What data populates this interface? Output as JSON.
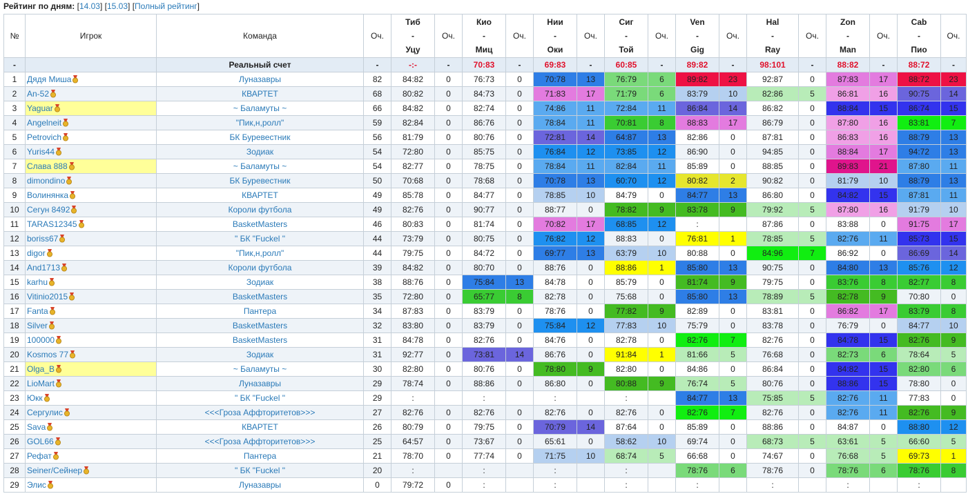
{
  "header": {
    "label": "Рейтинг по дням:",
    "links": [
      {
        "open": "[",
        "text": "14.03",
        "close": "]"
      },
      {
        "open": " [",
        "text": "15.03",
        "close": "]"
      },
      {
        "open": " [",
        "text": "Полный рейтинг",
        "close": "]"
      }
    ]
  },
  "columns": {
    "num": "№",
    "player": "Игрок",
    "team": "Команда",
    "points": "Оч.",
    "matches": [
      {
        "home": "Тиб",
        "sep": "-",
        "away": "Уцу"
      },
      {
        "home": "Кио",
        "sep": "-",
        "away": "Миц"
      },
      {
        "home": "Нии",
        "sep": "-",
        "away": "Оки"
      },
      {
        "home": "Сиг",
        "sep": "-",
        "away": "Той"
      },
      {
        "home": "Ven",
        "sep": "-",
        "away": "Gig"
      },
      {
        "home": "Hal",
        "sep": "-",
        "away": "Ray"
      },
      {
        "home": "Zon",
        "sep": "-",
        "away": "Man"
      },
      {
        "home": "Cab",
        "sep": "-",
        "away": "Пио"
      }
    ],
    "match_points": "Оч."
  },
  "real": {
    "num": "-",
    "label": "Реальный счет",
    "points": "-",
    "matches": [
      {
        "s": "-:-",
        "p": "-"
      },
      {
        "s": "70:83",
        "p": "-"
      },
      {
        "s": "69:83",
        "p": "-"
      },
      {
        "s": "60:85",
        "p": "-"
      },
      {
        "s": "89:82",
        "p": "-"
      },
      {
        "s": "98:101",
        "p": "-"
      },
      {
        "s": "88:82",
        "p": "-"
      },
      {
        "s": "88:72",
        "p": "-"
      }
    ]
  },
  "colors": {
    "23": "#ee1144",
    "21": "#e0148c",
    "17": "#e37bdf",
    "16": "#f0a0e6",
    "15": "#3333ee",
    "14": "#6b65dd",
    "13": "#2e7ee6",
    "12": "#1e90f0",
    "11": "#5aaaf0",
    "10": "#b5d0f0",
    "9": "#44bb22",
    "8": "#3acc33",
    "7": "#11ee11",
    "6": "#7ada7a",
    "5": "#b8ecb8",
    "2": "#e6e62e",
    "1": "#ffff00",
    "0": "none",
    "link": "#2a7ab8",
    "highlight": "#ffff99",
    "real_score": "#e0112b",
    "medal_gold": "#e8b42a",
    "medal_ribbon": "#d9442a"
  },
  "rows": [
    {
      "num": "1",
      "player": "Дядя Миша",
      "team": "Луназавры",
      "points": "82",
      "hl": false,
      "m": [
        [
          "84:82",
          "0"
        ],
        [
          "76:73",
          "0"
        ],
        [
          "70:78",
          "13"
        ],
        [
          "76:79",
          "6"
        ],
        [
          "89:82",
          "23"
        ],
        [
          "92:87",
          "0"
        ],
        [
          "87:83",
          "17"
        ],
        [
          "88:72",
          "23"
        ]
      ]
    },
    {
      "num": "2",
      "player": "An-52",
      "team": "КВАРТЕТ",
      "points": "68",
      "hl": false,
      "m": [
        [
          "80:82",
          "0"
        ],
        [
          "84:73",
          "0"
        ],
        [
          "71:83",
          "17"
        ],
        [
          "71:79",
          "6"
        ],
        [
          "83:79",
          "10"
        ],
        [
          "82:86",
          "5"
        ],
        [
          "86:81",
          "16"
        ],
        [
          "90:75",
          "14"
        ]
      ]
    },
    {
      "num": "3",
      "player": "Yaguar",
      "team": "~ Баламуты ~",
      "points": "66",
      "hl": true,
      "m": [
        [
          "84:82",
          "0"
        ],
        [
          "82:74",
          "0"
        ],
        [
          "74:86",
          "11"
        ],
        [
          "72:84",
          "11"
        ],
        [
          "86:84",
          "14"
        ],
        [
          "86:82",
          "0"
        ],
        [
          "88:84",
          "15"
        ],
        [
          "86:74",
          "15"
        ]
      ]
    },
    {
      "num": "4",
      "player": "Angelneit",
      "team": "\"Пик,н,ролл\"",
      "points": "59",
      "hl": false,
      "m": [
        [
          "82:84",
          "0"
        ],
        [
          "86:76",
          "0"
        ],
        [
          "78:84",
          "11"
        ],
        [
          "70:81",
          "8"
        ],
        [
          "88:83",
          "17"
        ],
        [
          "86:79",
          "0"
        ],
        [
          "87:80",
          "16"
        ],
        [
          "83:81",
          "7"
        ]
      ]
    },
    {
      "num": "5",
      "player": "Petrovich",
      "team": "БК Буревестник",
      "points": "56",
      "hl": false,
      "m": [
        [
          "81:79",
          "0"
        ],
        [
          "80:76",
          "0"
        ],
        [
          "72:81",
          "14"
        ],
        [
          "64:87",
          "13"
        ],
        [
          "82:86",
          "0"
        ],
        [
          "87:81",
          "0"
        ],
        [
          "86:83",
          "16"
        ],
        [
          "88:79",
          "13"
        ]
      ]
    },
    {
      "num": "6",
      "player": "Yuris44",
      "team": "Зодиак",
      "points": "54",
      "hl": false,
      "m": [
        [
          "72:80",
          "0"
        ],
        [
          "85:75",
          "0"
        ],
        [
          "76:84",
          "12"
        ],
        [
          "73:85",
          "12"
        ],
        [
          "86:90",
          "0"
        ],
        [
          "94:85",
          "0"
        ],
        [
          "88:84",
          "17"
        ],
        [
          "94:72",
          "13"
        ]
      ]
    },
    {
      "num": "7",
      "player": "Слава 888",
      "team": "~ Баламуты ~",
      "points": "54",
      "hl": true,
      "m": [
        [
          "82:77",
          "0"
        ],
        [
          "78:75",
          "0"
        ],
        [
          "78:84",
          "11"
        ],
        [
          "82:84",
          "11"
        ],
        [
          "85:89",
          "0"
        ],
        [
          "88:85",
          "0"
        ],
        [
          "89:83",
          "21"
        ],
        [
          "87:80",
          "11"
        ]
      ]
    },
    {
      "num": "8",
      "player": "dimondino",
      "team": "БК Буревестник",
      "points": "50",
      "hl": false,
      "m": [
        [
          "70:68",
          "0"
        ],
        [
          "78:68",
          "0"
        ],
        [
          "70:78",
          "13"
        ],
        [
          "60:70",
          "12"
        ],
        [
          "80:82",
          "2"
        ],
        [
          "90:82",
          "0"
        ],
        [
          "81:79",
          "10"
        ],
        [
          "88:79",
          "13"
        ]
      ]
    },
    {
      "num": "9",
      "player": "Волинянка",
      "team": "КВАРТЕТ",
      "points": "49",
      "hl": false,
      "m": [
        [
          "85:78",
          "0"
        ],
        [
          "84:77",
          "0"
        ],
        [
          "78:85",
          "10"
        ],
        [
          "84:79",
          "0"
        ],
        [
          "84:77",
          "13"
        ],
        [
          "86:80",
          "0"
        ],
        [
          "84:82",
          "15"
        ],
        [
          "87:81",
          "11"
        ]
      ]
    },
    {
      "num": "10",
      "player": "Сегун 8492",
      "team": "Короли футбола",
      "points": "49",
      "hl": false,
      "m": [
        [
          "82:76",
          "0"
        ],
        [
          "90:77",
          "0"
        ],
        [
          "88:77",
          "0"
        ],
        [
          "78:82",
          "9"
        ],
        [
          "83:78",
          "9"
        ],
        [
          "79:92",
          "5"
        ],
        [
          "87:80",
          "16"
        ],
        [
          "91:79",
          "10"
        ]
      ]
    },
    {
      "num": "11",
      "player": "TARAS12345",
      "team": "BasketMasters",
      "points": "46",
      "hl": false,
      "m": [
        [
          "80:83",
          "0"
        ],
        [
          "81:74",
          "0"
        ],
        [
          "70:82",
          "17"
        ],
        [
          "68:85",
          "12"
        ],
        [
          ":",
          ""
        ],
        [
          "87:86",
          "0"
        ],
        [
          "83:88",
          "0"
        ],
        [
          "91:75",
          "17"
        ]
      ]
    },
    {
      "num": "12",
      "player": "boriss67",
      "team": "\" БК \"Fuckel \"",
      "points": "44",
      "hl": false,
      "m": [
        [
          "73:79",
          "0"
        ],
        [
          "80:75",
          "0"
        ],
        [
          "76:82",
          "12"
        ],
        [
          "88:83",
          "0"
        ],
        [
          "76:81",
          "1"
        ],
        [
          "78:85",
          "5"
        ],
        [
          "82:76",
          "11"
        ],
        [
          "85:73",
          "15"
        ]
      ]
    },
    {
      "num": "13",
      "player": "digor",
      "team": "\"Пик,н,ролл\"",
      "points": "44",
      "hl": false,
      "m": [
        [
          "79:75",
          "0"
        ],
        [
          "84:72",
          "0"
        ],
        [
          "69:77",
          "13"
        ],
        [
          "63:79",
          "10"
        ],
        [
          "80:88",
          "0"
        ],
        [
          "84:96",
          "7"
        ],
        [
          "86:92",
          "0"
        ],
        [
          "86:69",
          "14"
        ]
      ]
    },
    {
      "num": "14",
      "player": "And1713",
      "team": "Короли футбола",
      "points": "39",
      "hl": false,
      "m": [
        [
          "84:82",
          "0"
        ],
        [
          "80:70",
          "0"
        ],
        [
          "88:76",
          "0"
        ],
        [
          "88:86",
          "1"
        ],
        [
          "85:80",
          "13"
        ],
        [
          "90:75",
          "0"
        ],
        [
          "84:80",
          "13"
        ],
        [
          "85:76",
          "12"
        ]
      ]
    },
    {
      "num": "15",
      "player": "karhu",
      "team": "Зодиак",
      "points": "38",
      "hl": false,
      "m": [
        [
          "88:76",
          "0"
        ],
        [
          "75:84",
          "13"
        ],
        [
          "84:78",
          "0"
        ],
        [
          "85:79",
          "0"
        ],
        [
          "81:74",
          "9"
        ],
        [
          "79:75",
          "0"
        ],
        [
          "83:76",
          "8"
        ],
        [
          "82:77",
          "8"
        ]
      ]
    },
    {
      "num": "16",
      "player": "Vitinio2015",
      "team": "BasketMasters",
      "points": "35",
      "hl": false,
      "m": [
        [
          "72:80",
          "0"
        ],
        [
          "65:77",
          "8"
        ],
        [
          "82:78",
          "0"
        ],
        [
          "75:68",
          "0"
        ],
        [
          "85:80",
          "13"
        ],
        [
          "78:89",
          "5"
        ],
        [
          "82:78",
          "9"
        ],
        [
          "70:80",
          "0"
        ]
      ]
    },
    {
      "num": "17",
      "player": "Fanta",
      "team": "Пантера",
      "points": "34",
      "hl": false,
      "m": [
        [
          "87:83",
          "0"
        ],
        [
          "83:79",
          "0"
        ],
        [
          "78:76",
          "0"
        ],
        [
          "77:82",
          "9"
        ],
        [
          "82:89",
          "0"
        ],
        [
          "83:81",
          "0"
        ],
        [
          "86:82",
          "17"
        ],
        [
          "83:79",
          "8"
        ]
      ]
    },
    {
      "num": "18",
      "player": "Silver",
      "team": "BasketMasters",
      "points": "32",
      "hl": false,
      "m": [
        [
          "83:80",
          "0"
        ],
        [
          "83:79",
          "0"
        ],
        [
          "75:84",
          "12"
        ],
        [
          "77:83",
          "10"
        ],
        [
          "75:79",
          "0"
        ],
        [
          "83:78",
          "0"
        ],
        [
          "76:79",
          "0"
        ],
        [
          "84:77",
          "10"
        ]
      ]
    },
    {
      "num": "19",
      "player": "100000",
      "team": "BasketMasters",
      "points": "31",
      "hl": false,
      "m": [
        [
          "84:78",
          "0"
        ],
        [
          "82:76",
          "0"
        ],
        [
          "84:76",
          "0"
        ],
        [
          "82:78",
          "0"
        ],
        [
          "82:76",
          "7"
        ],
        [
          "82:76",
          "0"
        ],
        [
          "84:78",
          "15"
        ],
        [
          "82:76",
          "9"
        ]
      ]
    },
    {
      "num": "20",
      "player": "Kosmos 77",
      "team": "Зодиак",
      "points": "31",
      "hl": false,
      "m": [
        [
          "92:77",
          "0"
        ],
        [
          "73:81",
          "14"
        ],
        [
          "86:76",
          "0"
        ],
        [
          "91:84",
          "1"
        ],
        [
          "81:66",
          "5"
        ],
        [
          "76:68",
          "0"
        ],
        [
          "82:73",
          "6"
        ],
        [
          "78:64",
          "5"
        ]
      ]
    },
    {
      "num": "21",
      "player": "Olga_B",
      "team": "~ Баламуты ~",
      "points": "30",
      "hl": true,
      "m": [
        [
          "82:80",
          "0"
        ],
        [
          "80:76",
          "0"
        ],
        [
          "78:80",
          "9"
        ],
        [
          "82:80",
          "0"
        ],
        [
          "84:86",
          "0"
        ],
        [
          "86:84",
          "0"
        ],
        [
          "84:82",
          "15"
        ],
        [
          "82:80",
          "6"
        ]
      ]
    },
    {
      "num": "22",
      "player": "LioMart",
      "team": "Луназавры",
      "points": "29",
      "hl": false,
      "m": [
        [
          "78:74",
          "0"
        ],
        [
          "88:86",
          "0"
        ],
        [
          "86:80",
          "0"
        ],
        [
          "80:88",
          "9"
        ],
        [
          "76:74",
          "5"
        ],
        [
          "80:76",
          "0"
        ],
        [
          "88:86",
          "15"
        ],
        [
          "78:80",
          "0"
        ]
      ]
    },
    {
      "num": "23",
      "player": "Юкк",
      "team": "\" БК \"Fuckel \"",
      "points": "29",
      "hl": false,
      "m": [
        [
          ":",
          ""
        ],
        [
          ":",
          ""
        ],
        [
          ":",
          ""
        ],
        [
          ":",
          ""
        ],
        [
          "84:77",
          "13"
        ],
        [
          "75:85",
          "5"
        ],
        [
          "82:76",
          "11"
        ],
        [
          "77:83",
          "0"
        ]
      ]
    },
    {
      "num": "24",
      "player": "Сергулис",
      "team": "<<<Гроза Аффторитетов>>>",
      "points": "27",
      "hl": false,
      "m": [
        [
          "82:76",
          "0"
        ],
        [
          "82:76",
          "0"
        ],
        [
          "82:76",
          "0"
        ],
        [
          "82:76",
          "0"
        ],
        [
          "82:76",
          "7"
        ],
        [
          "82:76",
          "0"
        ],
        [
          "82:76",
          "11"
        ],
        [
          "82:76",
          "9"
        ]
      ]
    },
    {
      "num": "25",
      "player": "Sava",
      "team": "КВАРТЕТ",
      "points": "26",
      "hl": false,
      "m": [
        [
          "80:79",
          "0"
        ],
        [
          "79:75",
          "0"
        ],
        [
          "70:79",
          "14"
        ],
        [
          "87:64",
          "0"
        ],
        [
          "85:89",
          "0"
        ],
        [
          "88:86",
          "0"
        ],
        [
          "84:87",
          "0"
        ],
        [
          "88:80",
          "12"
        ]
      ]
    },
    {
      "num": "26",
      "player": "GOL66",
      "team": "<<<Гроза Аффторитетов>>>",
      "points": "25",
      "hl": false,
      "m": [
        [
          "64:57",
          "0"
        ],
        [
          "73:67",
          "0"
        ],
        [
          "65:61",
          "0"
        ],
        [
          "58:62",
          "10"
        ],
        [
          "69:74",
          "0"
        ],
        [
          "68:73",
          "5"
        ],
        [
          "63:61",
          "5"
        ],
        [
          "66:60",
          "5"
        ]
      ]
    },
    {
      "num": "27",
      "player": "Рефат",
      "team": "Пантера",
      "points": "21",
      "hl": false,
      "m": [
        [
          "78:70",
          "0"
        ],
        [
          "77:74",
          "0"
        ],
        [
          "71:75",
          "10"
        ],
        [
          "68:74",
          "5"
        ],
        [
          "66:68",
          "0"
        ],
        [
          "74:67",
          "0"
        ],
        [
          "76:68",
          "5"
        ],
        [
          "69:73",
          "1"
        ]
      ]
    },
    {
      "num": "28",
      "player": "Seiner/Сейнер",
      "team": "\" БК \"Fuckel \"",
      "points": "20",
      "hl": false,
      "m": [
        [
          ":",
          ""
        ],
        [
          ":",
          ""
        ],
        [
          ":",
          ""
        ],
        [
          ":",
          ""
        ],
        [
          "78:76",
          "6"
        ],
        [
          "78:76",
          "0"
        ],
        [
          "78:76",
          "6"
        ],
        [
          "78:76",
          "8"
        ]
      ]
    },
    {
      "num": "29",
      "player": "Элис",
      "team": "Луназавры",
      "points": "0",
      "hl": false,
      "m": [
        [
          "79:72",
          "0"
        ],
        [
          ":",
          ""
        ],
        [
          ":",
          ""
        ],
        [
          ":",
          ""
        ],
        [
          ":",
          ""
        ],
        [
          ":",
          ""
        ],
        [
          ":",
          ""
        ],
        [
          ":",
          ""
        ]
      ]
    }
  ]
}
